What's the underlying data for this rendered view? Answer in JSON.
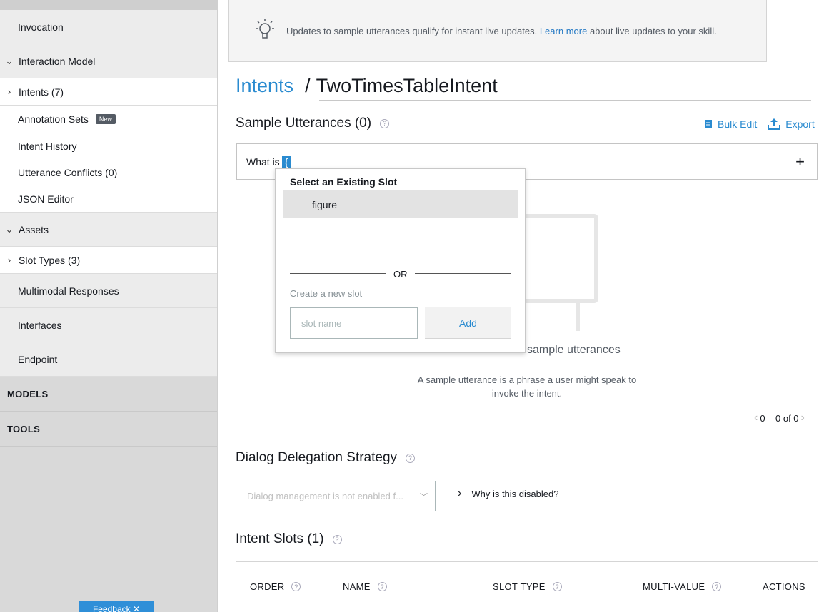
{
  "sidebar": {
    "items": [
      {
        "label": "Invocation"
      },
      {
        "label": "Interaction Model"
      },
      {
        "label": "Intents (7)"
      },
      {
        "label": "Annotation Sets",
        "badge": "New"
      },
      {
        "label": "Intent History"
      },
      {
        "label": "Utterance Conflicts (0)"
      },
      {
        "label": "JSON Editor"
      },
      {
        "label": "Assets"
      },
      {
        "label": "Slot Types (3)"
      },
      {
        "label": "Multimodal Responses"
      },
      {
        "label": "Interfaces"
      },
      {
        "label": "Endpoint"
      }
    ],
    "sections": [
      "MODELS",
      "TOOLS"
    ],
    "feedback": "Feedback ✕"
  },
  "banner": {
    "text_before": "Updates to sample utterances qualify for instant live updates.",
    "link": "Learn more",
    "text_after": "about live updates to your skill."
  },
  "breadcrumb": {
    "parent": "Intents",
    "separator": "/",
    "current": "TwoTimesTableIntent"
  },
  "sample_utterances": {
    "title": "Sample Utterances (0)",
    "bulk_edit": "Bulk Edit",
    "export": "Export",
    "input_text": "What is",
    "selected_char": "{",
    "add_symbol": "+",
    "empty_title": "This intent has no sample utterances",
    "empty_desc_line1": "A sample utterance is a phrase a user might speak to",
    "empty_desc_line2": "invoke the intent.",
    "pager": "0 – 0 of 0"
  },
  "slot_popup": {
    "title": "Select an Existing Slot",
    "existing": [
      "figure"
    ],
    "or": "OR",
    "create_label": "Create a new slot",
    "placeholder": "slot name",
    "add": "Add"
  },
  "dialog_delegation": {
    "title": "Dialog Delegation Strategy",
    "select_value": "Dialog management is not enabled f...",
    "why": "Why is this disabled?"
  },
  "intent_slots": {
    "title": "Intent Slots (1)",
    "columns": [
      "ORDER",
      "NAME",
      "SLOT TYPE",
      "MULTI-VALUE",
      "ACTIONS"
    ]
  },
  "colors": {
    "accent": "#2a8bd0",
    "sidebar_bg": "#d9d9d9"
  }
}
